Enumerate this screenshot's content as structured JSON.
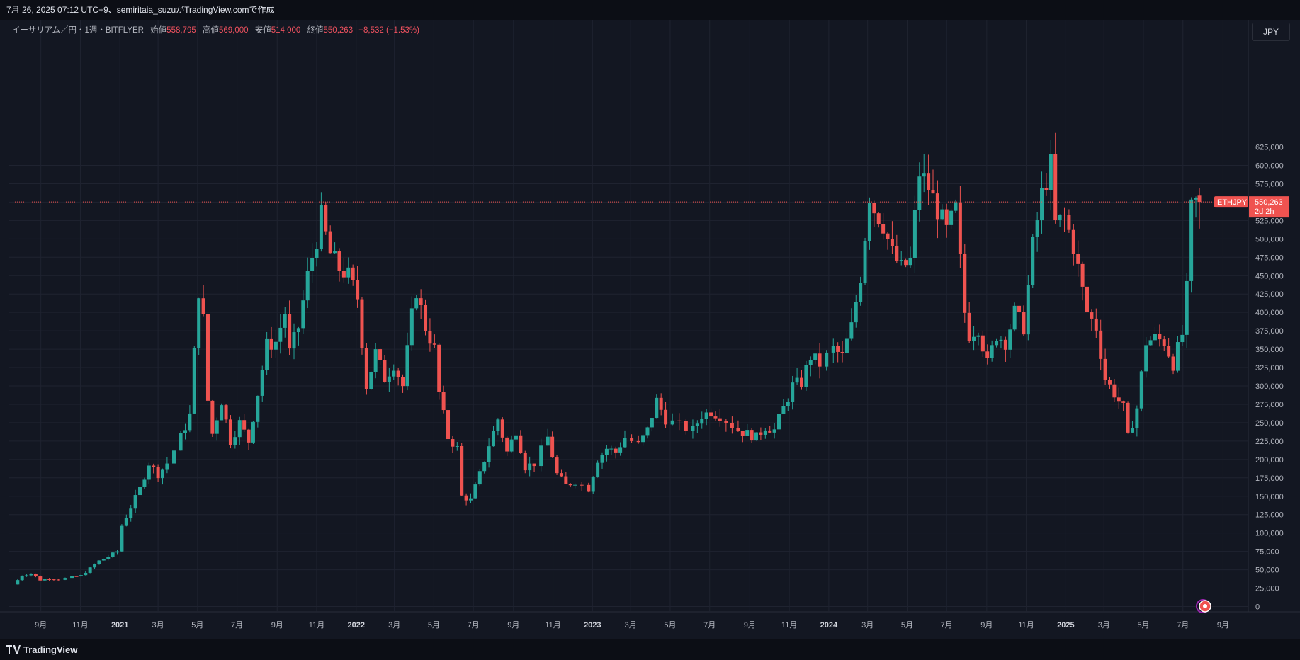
{
  "header": {
    "text": "7月 26, 2025 07:12 UTC+9、semiritaia_suzuがTradingView.comで作成"
  },
  "legend": {
    "title": "イーサリアム／円・1週・BITFLYER",
    "open_label": "始値",
    "open": "558,795",
    "high_label": "高値",
    "high": "569,000",
    "low_label": "安値",
    "low": "514,000",
    "close_label": "終値",
    "close": "550,263",
    "change": "−8,532 (−1.53%)"
  },
  "currency_button": "JPY",
  "price_label": {
    "symbol": "ETHJPY",
    "price": "550,263",
    "countdown": "2d 2h"
  },
  "footer": {
    "brand": "TradingView",
    "logo_icon": "tradingview-logo-icon"
  },
  "colors": {
    "up": "#26a69a",
    "down": "#ef5350",
    "background": "#131722",
    "grid": "#1f2330"
  },
  "chart_data": {
    "type": "candlestick",
    "symbol": "ETHJPY",
    "interval": "1W",
    "y_ticks": [
      0,
      25000,
      50000,
      75000,
      100000,
      125000,
      150000,
      175000,
      200000,
      225000,
      250000,
      275000,
      300000,
      325000,
      350000,
      375000,
      400000,
      425000,
      450000,
      475000,
      500000,
      525000,
      550000,
      575000,
      600000,
      625000
    ],
    "y_tick_labels": [
      "0",
      "25,000",
      "50,000",
      "75,000",
      "100,000",
      "125,000",
      "150,000",
      "175,000",
      "200,000",
      "225,000",
      "250,000",
      "275,000",
      "300,000",
      "325,000",
      "350,000",
      "375,000",
      "400,000",
      "425,000",
      "450,000",
      "475,000",
      "500,000",
      "525,000",
      "550,000",
      "575,000",
      "600,000",
      "625,000"
    ],
    "x_ticks": [
      {
        "label": "9月",
        "date": "2020-09-01",
        "year": false
      },
      {
        "label": "11月",
        "date": "2020-11-01",
        "year": false
      },
      {
        "label": "2021",
        "date": "2021-01-01",
        "year": true
      },
      {
        "label": "3月",
        "date": "2021-03-01",
        "year": false
      },
      {
        "label": "5月",
        "date": "2021-05-01",
        "year": false
      },
      {
        "label": "7月",
        "date": "2021-07-01",
        "year": false
      },
      {
        "label": "9月",
        "date": "2021-09-01",
        "year": false
      },
      {
        "label": "11月",
        "date": "2021-11-01",
        "year": false
      },
      {
        "label": "2022",
        "date": "2022-01-01",
        "year": true
      },
      {
        "label": "3月",
        "date": "2022-03-01",
        "year": false
      },
      {
        "label": "5月",
        "date": "2022-05-01",
        "year": false
      },
      {
        "label": "7月",
        "date": "2022-07-01",
        "year": false
      },
      {
        "label": "9月",
        "date": "2022-09-01",
        "year": false
      },
      {
        "label": "11月",
        "date": "2022-11-01",
        "year": false
      },
      {
        "label": "2023",
        "date": "2023-01-01",
        "year": true
      },
      {
        "label": "3月",
        "date": "2023-03-01",
        "year": false
      },
      {
        "label": "5月",
        "date": "2023-05-01",
        "year": false
      },
      {
        "label": "7月",
        "date": "2023-07-01",
        "year": false
      },
      {
        "label": "9月",
        "date": "2023-09-01",
        "year": false
      },
      {
        "label": "11月",
        "date": "2023-11-01",
        "year": false
      },
      {
        "label": "2024",
        "date": "2024-01-01",
        "year": true
      },
      {
        "label": "3月",
        "date": "2024-03-01",
        "year": false
      },
      {
        "label": "5月",
        "date": "2024-05-01",
        "year": false
      },
      {
        "label": "7月",
        "date": "2024-07-01",
        "year": false
      },
      {
        "label": "9月",
        "date": "2024-09-01",
        "year": false
      },
      {
        "label": "11月",
        "date": "2024-11-01",
        "year": false
      },
      {
        "label": "2025",
        "date": "2025-01-01",
        "year": true
      },
      {
        "label": "3月",
        "date": "2025-03-01",
        "year": false
      },
      {
        "label": "5月",
        "date": "2025-05-01",
        "year": false
      },
      {
        "label": "7月",
        "date": "2025-07-01",
        "year": false
      },
      {
        "label": "9月",
        "date": "2025-09-01",
        "year": false
      }
    ],
    "current_price": 550263,
    "price_series": [
      [
        "2020-07-20",
        30000
      ],
      [
        "2020-08-03",
        42000
      ],
      [
        "2020-08-17",
        45000
      ],
      [
        "2020-08-31",
        36000
      ],
      [
        "2020-09-14",
        38000
      ],
      [
        "2020-09-28",
        37000
      ],
      [
        "2020-10-19",
        40000
      ],
      [
        "2020-11-02",
        42000
      ],
      [
        "2020-11-16",
        52000
      ],
      [
        "2020-11-30",
        62000
      ],
      [
        "2020-12-14",
        68000
      ],
      [
        "2020-12-28",
        75000
      ],
      [
        "2021-01-04",
        110000
      ],
      [
        "2021-01-18",
        135000
      ],
      [
        "2021-02-01",
        160000
      ],
      [
        "2021-02-15",
        195000
      ],
      [
        "2021-03-01",
        180000
      ],
      [
        "2021-03-15",
        195000
      ],
      [
        "2021-04-05",
        230000
      ],
      [
        "2021-04-19",
        260000
      ],
      [
        "2021-05-03",
        430000
      ],
      [
        "2021-05-10",
        390000
      ],
      [
        "2021-05-17",
        280000
      ],
      [
        "2021-05-24",
        235000
      ],
      [
        "2021-06-07",
        280000
      ],
      [
        "2021-06-21",
        225000
      ],
      [
        "2021-07-05",
        250000
      ],
      [
        "2021-07-19",
        225000
      ],
      [
        "2021-08-02",
        290000
      ],
      [
        "2021-08-16",
        355000
      ],
      [
        "2021-08-30",
        360000
      ],
      [
        "2021-09-13",
        400000
      ],
      [
        "2021-09-20",
        345000
      ],
      [
        "2021-10-04",
        380000
      ],
      [
        "2021-10-18",
        450000
      ],
      [
        "2021-11-01",
        500000
      ],
      [
        "2021-11-08",
        530000
      ],
      [
        "2021-11-22",
        480000
      ],
      [
        "2021-12-06",
        460000
      ],
      [
        "2021-12-20",
        450000
      ],
      [
        "2022-01-03",
        420000
      ],
      [
        "2022-01-17",
        300000
      ],
      [
        "2022-01-31",
        345000
      ],
      [
        "2022-02-14",
        310000
      ],
      [
        "2022-02-28",
        330000
      ],
      [
        "2022-03-14",
        300000
      ],
      [
        "2022-03-28",
        395000
      ],
      [
        "2022-04-04",
        430000
      ],
      [
        "2022-04-18",
        380000
      ],
      [
        "2022-05-02",
        350000
      ],
      [
        "2022-05-09",
        290000
      ],
      [
        "2022-05-23",
        230000
      ],
      [
        "2022-06-06",
        215000
      ],
      [
        "2022-06-13",
        150000
      ],
      [
        "2022-06-27",
        145000
      ],
      [
        "2022-07-11",
        180000
      ],
      [
        "2022-07-25",
        220000
      ],
      [
        "2022-08-08",
        255000
      ],
      [
        "2022-08-22",
        210000
      ],
      [
        "2022-09-05",
        240000
      ],
      [
        "2022-09-19",
        190000
      ],
      [
        "2022-10-03",
        195000
      ],
      [
        "2022-10-24",
        230000
      ],
      [
        "2022-11-07",
        180000
      ],
      [
        "2022-11-21",
        165000
      ],
      [
        "2022-12-05",
        170000
      ],
      [
        "2022-12-26",
        160000
      ],
      [
        "2023-01-09",
        200000
      ],
      [
        "2023-01-23",
        215000
      ],
      [
        "2023-02-06",
        210000
      ],
      [
        "2023-02-20",
        230000
      ],
      [
        "2023-03-13",
        220000
      ],
      [
        "2023-03-27",
        240000
      ],
      [
        "2023-04-10",
        280000
      ],
      [
        "2023-04-24",
        255000
      ],
      [
        "2023-05-15",
        245000
      ],
      [
        "2023-06-05",
        240000
      ],
      [
        "2023-06-19",
        260000
      ],
      [
        "2023-07-03",
        265000
      ],
      [
        "2023-07-17",
        260000
      ],
      [
        "2023-08-14",
        240000
      ],
      [
        "2023-08-28",
        235000
      ],
      [
        "2023-09-11",
        230000
      ],
      [
        "2023-09-25",
        245000
      ],
      [
        "2023-10-09",
        240000
      ],
      [
        "2023-10-23",
        270000
      ],
      [
        "2023-11-06",
        300000
      ],
      [
        "2023-11-20",
        305000
      ],
      [
        "2023-12-04",
        340000
      ],
      [
        "2023-12-18",
        330000
      ],
      [
        "2024-01-08",
        350000
      ],
      [
        "2024-01-22",
        340000
      ],
      [
        "2024-02-05",
        380000
      ],
      [
        "2024-02-19",
        450000
      ],
      [
        "2024-03-04",
        560000
      ],
      [
        "2024-03-11",
        540000
      ],
      [
        "2024-03-25",
        520000
      ],
      [
        "2024-04-08",
        480000
      ],
      [
        "2024-04-22",
        460000
      ],
      [
        "2024-05-06",
        470000
      ],
      [
        "2024-05-20",
        590000
      ],
      [
        "2024-06-03",
        570000
      ],
      [
        "2024-06-17",
        540000
      ],
      [
        "2024-07-01",
        510000
      ],
      [
        "2024-07-15",
        540000
      ],
      [
        "2024-07-29",
        400000
      ],
      [
        "2024-08-05",
        370000
      ],
      [
        "2024-08-19",
        380000
      ],
      [
        "2024-09-02",
        330000
      ],
      [
        "2024-09-16",
        370000
      ],
      [
        "2024-09-30",
        360000
      ],
      [
        "2024-10-14",
        400000
      ],
      [
        "2024-10-28",
        380000
      ],
      [
        "2024-11-11",
        490000
      ],
      [
        "2024-11-25",
        560000
      ],
      [
        "2024-12-09",
        600000
      ],
      [
        "2024-12-16",
        520000
      ],
      [
        "2024-12-30",
        530000
      ],
      [
        "2025-01-13",
        490000
      ],
      [
        "2025-01-27",
        430000
      ],
      [
        "2025-02-03",
        400000
      ],
      [
        "2025-02-17",
        380000
      ],
      [
        "2025-03-03",
        310000
      ],
      [
        "2025-03-17",
        290000
      ],
      [
        "2025-03-31",
        270000
      ],
      [
        "2025-04-07",
        230000
      ],
      [
        "2025-04-21",
        270000
      ],
      [
        "2025-05-05",
        360000
      ],
      [
        "2025-05-19",
        365000
      ],
      [
        "2025-06-02",
        360000
      ],
      [
        "2025-06-16",
        330000
      ],
      [
        "2025-06-30",
        370000
      ],
      [
        "2025-07-07",
        430000
      ],
      [
        "2025-07-14",
        540000
      ],
      [
        "2025-07-21",
        550263
      ]
    ],
    "grid": true,
    "legend_position": "top-left"
  }
}
